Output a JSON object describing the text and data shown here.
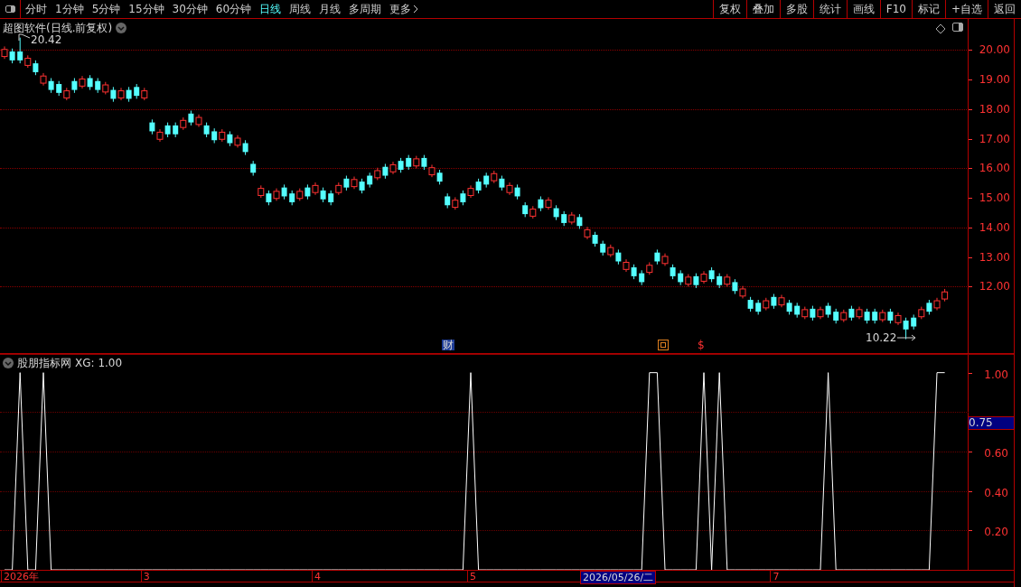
{
  "toolbar": {
    "periods": [
      {
        "label": "分时",
        "selected": false
      },
      {
        "label": "1分钟",
        "selected": false
      },
      {
        "label": "5分钟",
        "selected": false
      },
      {
        "label": "15分钟",
        "selected": false
      },
      {
        "label": "30分钟",
        "selected": false
      },
      {
        "label": "60分钟",
        "selected": false
      },
      {
        "label": "日线",
        "selected": true
      },
      {
        "label": "周线",
        "selected": false
      },
      {
        "label": "月线",
        "selected": false
      },
      {
        "label": "多周期",
        "selected": false
      },
      {
        "label": "更多",
        "selected": false
      }
    ],
    "buttons": [
      "复权",
      "叠加",
      "多股",
      "统计",
      "画线",
      "F10",
      "标记",
      "+自选",
      "返回"
    ]
  },
  "price_panel": {
    "title": "超图软件(日线.前复权)",
    "high_label": "20.42",
    "low_label": "10.22",
    "event_marks": [
      {
        "kind": "text",
        "label": "财"
      },
      {
        "kind": "square"
      },
      {
        "kind": "text",
        "label": "$"
      }
    ],
    "chart_data": {
      "type": "candlestick",
      "ylim": [
        9.75,
        21.05
      ],
      "grid": true,
      "yticks": [
        {
          "value": 20,
          "label": "20.00"
        },
        {
          "value": 19,
          "label": "19.00"
        },
        {
          "value": 18,
          "label": "18.00"
        },
        {
          "value": 17,
          "label": "17.00"
        },
        {
          "value": 16,
          "label": "16.00"
        },
        {
          "value": 15,
          "label": "15.00"
        },
        {
          "value": 14,
          "label": "14.00"
        },
        {
          "value": 13,
          "label": "13.00"
        },
        {
          "value": 12,
          "label": "12.00"
        }
      ],
      "ohlc": [
        [
          19.78,
          20.12,
          19.7,
          20.02
        ],
        [
          19.95,
          20.05,
          19.55,
          19.65
        ],
        [
          19.95,
          20.42,
          19.55,
          19.65
        ],
        [
          19.48,
          19.82,
          19.4,
          19.72
        ],
        [
          19.55,
          19.65,
          19.15,
          19.25
        ],
        [
          18.88,
          19.22,
          18.8,
          19.12
        ],
        [
          18.95,
          19.05,
          18.55,
          18.65
        ],
        [
          18.85,
          18.95,
          18.45,
          18.55
        ],
        [
          18.38,
          18.72,
          18.3,
          18.62
        ],
        [
          18.95,
          19.05,
          18.55,
          18.65
        ],
        [
          18.78,
          19.12,
          18.7,
          19.02
        ],
        [
          19.05,
          19.15,
          18.65,
          18.75
        ],
        [
          18.95,
          19.05,
          18.55,
          18.65
        ],
        [
          18.58,
          18.92,
          18.5,
          18.82
        ],
        [
          18.65,
          18.75,
          18.25,
          18.35
        ],
        [
          18.38,
          18.72,
          18.3,
          18.62
        ],
        [
          18.65,
          18.75,
          18.25,
          18.35
        ],
        [
          18.75,
          18.85,
          18.35,
          18.45
        ],
        [
          18.38,
          18.72,
          18.3,
          18.62
        ],
        [
          17.55,
          17.65,
          17.15,
          17.25
        ],
        [
          16.98,
          17.32,
          16.9,
          17.22
        ],
        [
          17.45,
          17.55,
          17.05,
          17.15
        ],
        [
          17.45,
          17.55,
          17.05,
          17.15
        ],
        [
          17.38,
          17.72,
          17.3,
          17.62
        ],
        [
          17.85,
          17.95,
          17.45,
          17.55
        ],
        [
          17.48,
          17.82,
          17.4,
          17.72
        ],
        [
          17.45,
          17.55,
          17.05,
          17.15
        ],
        [
          17.25,
          17.35,
          16.85,
          16.95
        ],
        [
          16.98,
          17.32,
          16.9,
          17.22
        ],
        [
          17.15,
          17.25,
          16.75,
          16.85
        ],
        [
          16.78,
          17.12,
          16.7,
          17.02
        ],
        [
          16.85,
          16.95,
          16.45,
          16.55
        ],
        [
          16.15,
          16.25,
          15.75,
          15.85
        ],
        [
          15.08,
          15.42,
          15.0,
          15.32
        ],
        [
          15.15,
          15.25,
          14.75,
          14.85
        ],
        [
          14.98,
          15.32,
          14.9,
          15.22
        ],
        [
          15.35,
          15.45,
          14.95,
          15.05
        ],
        [
          15.15,
          15.25,
          14.75,
          14.85
        ],
        [
          14.98,
          15.32,
          14.9,
          15.22
        ],
        [
          15.35,
          15.45,
          14.95,
          15.05
        ],
        [
          15.18,
          15.52,
          15.1,
          15.42
        ],
        [
          15.25,
          15.35,
          14.85,
          14.95
        ],
        [
          15.15,
          15.25,
          14.75,
          14.85
        ],
        [
          15.18,
          15.52,
          15.1,
          15.42
        ],
        [
          15.65,
          15.75,
          15.25,
          15.35
        ],
        [
          15.38,
          15.72,
          15.3,
          15.62
        ],
        [
          15.55,
          15.65,
          15.15,
          15.25
        ],
        [
          15.75,
          15.85,
          15.35,
          15.45
        ],
        [
          15.68,
          16.02,
          15.6,
          15.92
        ],
        [
          16.05,
          16.15,
          15.65,
          15.75
        ],
        [
          15.88,
          16.22,
          15.8,
          16.12
        ],
        [
          16.25,
          16.35,
          15.85,
          15.95
        ],
        [
          16.35,
          16.45,
          15.95,
          16.05
        ],
        [
          16.08,
          16.42,
          16.0,
          16.32
        ],
        [
          16.35,
          16.45,
          15.95,
          16.05
        ],
        [
          15.78,
          16.12,
          15.7,
          16.02
        ],
        [
          15.85,
          15.95,
          15.45,
          15.55
        ],
        [
          15.05,
          15.15,
          14.65,
          14.75
        ],
        [
          14.68,
          15.02,
          14.6,
          14.92
        ],
        [
          15.15,
          15.25,
          14.75,
          14.85
        ],
        [
          15.08,
          15.42,
          15.0,
          15.32
        ],
        [
          15.55,
          15.65,
          15.15,
          15.25
        ],
        [
          15.75,
          15.85,
          15.35,
          15.45
        ],
        [
          15.58,
          15.92,
          15.5,
          15.82
        ],
        [
          15.65,
          15.75,
          15.25,
          15.35
        ],
        [
          15.18,
          15.52,
          15.1,
          15.42
        ],
        [
          15.35,
          15.45,
          14.95,
          15.05
        ],
        [
          14.75,
          14.85,
          14.35,
          14.45
        ],
        [
          14.38,
          14.72,
          14.3,
          14.62
        ],
        [
          14.95,
          15.05,
          14.55,
          14.65
        ],
        [
          14.68,
          15.02,
          14.6,
          14.92
        ],
        [
          14.65,
          14.75,
          14.25,
          14.35
        ],
        [
          14.45,
          14.55,
          14.05,
          14.15
        ],
        [
          14.18,
          14.52,
          14.1,
          14.42
        ],
        [
          14.35,
          14.45,
          13.95,
          14.05
        ],
        [
          13.68,
          14.02,
          13.6,
          13.92
        ],
        [
          13.75,
          13.85,
          13.35,
          13.45
        ],
        [
          13.45,
          13.55,
          13.05,
          13.15
        ],
        [
          13.08,
          13.42,
          13.0,
          13.32
        ],
        [
          13.15,
          13.25,
          12.75,
          12.85
        ],
        [
          12.58,
          12.92,
          12.5,
          12.82
        ],
        [
          12.65,
          12.75,
          12.25,
          12.35
        ],
        [
          12.45,
          12.55,
          12.05,
          12.15
        ],
        [
          12.48,
          12.82,
          12.4,
          12.72
        ],
        [
          13.15,
          13.25,
          12.75,
          12.85
        ],
        [
          12.78,
          13.12,
          12.7,
          13.02
        ],
        [
          12.65,
          12.75,
          12.25,
          12.35
        ],
        [
          12.45,
          12.55,
          12.05,
          12.15
        ],
        [
          12.08,
          12.42,
          12.0,
          12.32
        ],
        [
          12.35,
          12.45,
          11.95,
          12.05
        ],
        [
          12.18,
          12.52,
          12.1,
          12.42
        ],
        [
          12.55,
          12.65,
          12.15,
          12.25
        ],
        [
          12.35,
          12.45,
          11.95,
          12.05
        ],
        [
          12.08,
          12.42,
          12.0,
          12.32
        ],
        [
          12.15,
          12.25,
          11.75,
          11.85
        ],
        [
          11.68,
          12.02,
          11.6,
          11.92
        ],
        [
          11.55,
          11.65,
          11.15,
          11.25
        ],
        [
          11.45,
          11.55,
          11.05,
          11.15
        ],
        [
          11.28,
          11.62,
          11.2,
          11.52
        ],
        [
          11.65,
          11.75,
          11.25,
          11.35
        ],
        [
          11.38,
          11.72,
          11.3,
          11.62
        ],
        [
          11.45,
          11.55,
          11.05,
          11.15
        ],
        [
          11.35,
          11.45,
          10.95,
          11.05
        ],
        [
          10.98,
          11.32,
          10.9,
          11.22
        ],
        [
          11.25,
          11.35,
          10.85,
          10.95
        ],
        [
          10.98,
          11.32,
          10.9,
          11.22
        ],
        [
          11.35,
          11.45,
          10.95,
          11.05
        ],
        [
          11.15,
          11.25,
          10.75,
          10.85
        ],
        [
          10.88,
          11.22,
          10.8,
          11.12
        ],
        [
          11.25,
          11.35,
          10.85,
          10.95
        ],
        [
          10.98,
          11.32,
          10.9,
          11.22
        ],
        [
          11.15,
          11.25,
          10.75,
          10.85
        ],
        [
          11.15,
          11.25,
          10.75,
          10.85
        ],
        [
          10.88,
          11.22,
          10.8,
          11.12
        ],
        [
          11.15,
          11.25,
          10.75,
          10.85
        ],
        [
          10.78,
          11.12,
          10.7,
          11.02
        ],
        [
          10.85,
          10.95,
          10.22,
          10.55
        ],
        [
          10.95,
          11.05,
          10.55,
          10.65
        ],
        [
          10.98,
          11.32,
          10.9,
          11.22
        ],
        [
          11.45,
          11.55,
          11.05,
          11.15
        ],
        [
          11.28,
          11.62,
          11.2,
          11.52
        ],
        [
          11.58,
          11.92,
          11.5,
          11.82
        ]
      ]
    }
  },
  "indicator_panel": {
    "title": "股朋指标网",
    "reading": "XG: 1.00",
    "cursor_value": "0.75",
    "chart_data": {
      "type": "line",
      "series": [
        {
          "color": "#ffffff",
          "values": [
            0,
            0,
            1,
            0,
            0,
            1,
            0,
            0,
            0,
            0,
            0,
            0,
            0,
            0,
            0,
            0,
            0,
            0,
            0,
            0,
            0,
            0,
            0,
            0,
            0,
            0,
            0,
            0,
            0,
            0,
            0,
            0,
            0,
            0,
            0,
            0,
            0,
            0,
            0,
            0,
            0,
            0,
            0,
            0,
            0,
            0,
            0,
            0,
            0,
            0,
            0,
            0,
            0,
            0,
            0,
            0,
            0,
            0,
            0,
            0,
            1,
            0,
            0,
            0,
            0,
            0,
            0,
            0,
            0,
            0,
            0,
            0,
            0,
            0,
            0,
            0,
            0,
            0,
            0,
            0,
            0,
            0,
            0,
            1,
            1,
            0,
            0,
            0,
            0,
            0,
            1,
            0,
            1,
            0,
            0,
            0,
            0,
            0,
            0,
            0,
            0,
            0,
            0,
            0,
            0,
            0,
            1,
            0,
            0,
            0,
            0,
            0,
            0,
            0,
            0,
            0,
            0,
            0,
            0,
            0,
            1,
            1
          ]
        }
      ],
      "ylim": [
        0,
        1.09
      ],
      "grid": true,
      "yticks": [
        {
          "value": 1,
          "label": "1.00"
        },
        {
          "value": 0.6,
          "label": "0.60"
        },
        {
          "value": 0.4,
          "label": "0.40"
        },
        {
          "value": 0.2,
          "label": "0.20"
        }
      ]
    }
  },
  "date_axis": {
    "labels": [
      "2026年",
      "3",
      "4",
      "5",
      "7"
    ],
    "cursor_date": "2026/05/26/二"
  }
}
